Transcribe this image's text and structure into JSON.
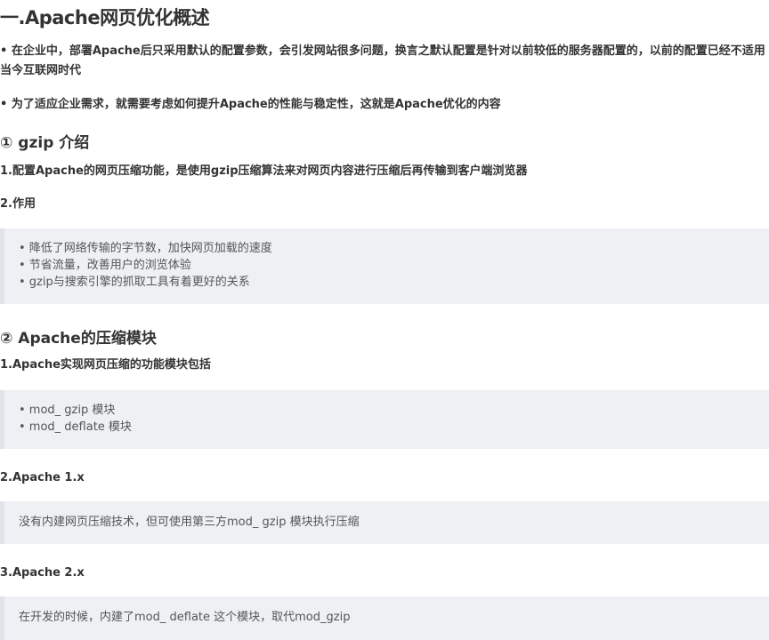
{
  "title": "一.Apache网页优化概述",
  "intro": [
    "• 在企业中，部署Apache后只采用默认的配置参数，会引发网站很多问题，换言之默认配置是针对以前较低的服务器配置的，以前的配置已经不适用当今互联网时代",
    "• 为了适应企业需求，就需要考虑如何提升Apache的性能与稳定性，这就是Apache优化的内容"
  ],
  "section1": {
    "heading": "① gzip 介绍",
    "p1": "1.配置Apache的网页压缩功能，是使用gzip压缩算法来对网页内容进行压缩后再传输到客户端浏览器",
    "p2": "2.作用",
    "items": [
      "• 降低了网络传输的字节数，加快网页加载的速度",
      "• 节省流量，改善用户的浏览体验",
      "• gzip与搜索引擎的抓取工具有着更好的关系"
    ]
  },
  "section2": {
    "heading": "② Apache的压缩模块",
    "p1": "1.Apache实现网页压缩的功能模块包括",
    "items": [
      "• mod_ gzip 模块",
      "• mod_ deflate 模块"
    ],
    "p2": "2.Apache 1.x",
    "note2": "没有内建网页压缩技术，但可使用第三方mod_ gzip 模块执行压缩",
    "p3": "3.Apache 2.x",
    "note3": "在开发的时候，内建了mod_ deflate 这个模块，取代mod_gzip"
  }
}
